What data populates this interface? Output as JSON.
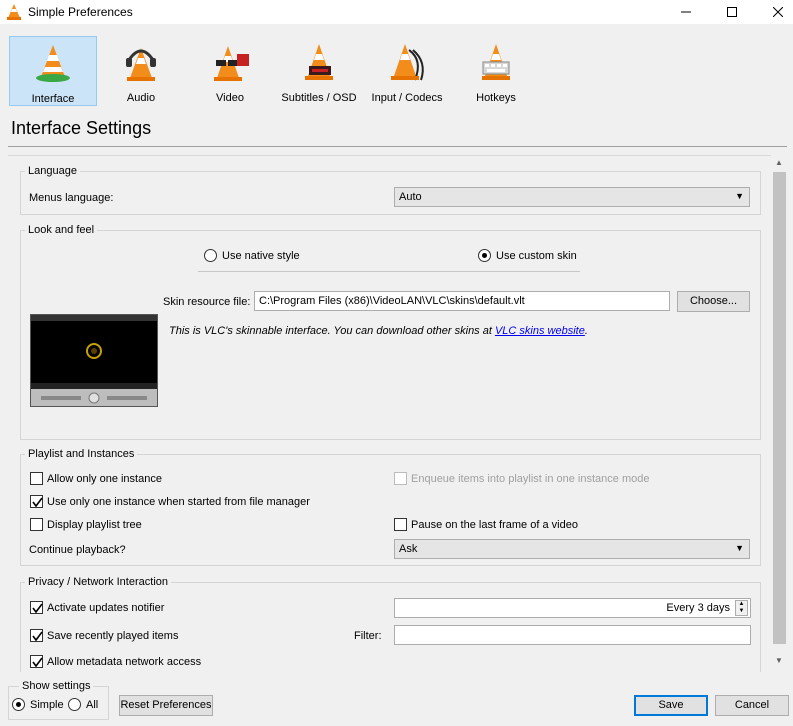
{
  "window": {
    "title": "Simple Preferences",
    "minimize_icon": "minimize-icon",
    "maximize_icon": "maximize-icon",
    "close_icon": "close-icon"
  },
  "categories": [
    {
      "label": "Interface",
      "icon": "interface-cone-icon",
      "selected": true
    },
    {
      "label": "Audio",
      "icon": "audio-headphones-cone-icon",
      "selected": false
    },
    {
      "label": "Video",
      "icon": "video-glasses-cone-icon",
      "selected": false
    },
    {
      "label": "Subtitles / OSD",
      "icon": "subtitles-cone-icon",
      "selected": false
    },
    {
      "label": "Input / Codecs",
      "icon": "input-codecs-cone-icon",
      "selected": false
    },
    {
      "label": "Hotkeys",
      "icon": "hotkeys-cone-icon",
      "selected": false
    }
  ],
  "settings_title": "Interface Settings",
  "language": {
    "group_title": "Language",
    "menus_label": "Menus language:",
    "menus_value": "Auto"
  },
  "look": {
    "group_title": "Look and feel",
    "native_label": "Use native style",
    "custom_label": "Use custom skin",
    "selected": "custom",
    "skin_label": "Skin resource file:",
    "skin_value": "C:\\Program Files (x86)\\VideoLAN\\VLC\\skins\\default.vlt",
    "choose_label": "Choose...",
    "info_text": "This is VLC's skinnable interface. You can download other skins at ",
    "link_text": "VLC skins website",
    "info_end": "."
  },
  "playlist": {
    "group_title": "Playlist and Instances",
    "one_instance": {
      "label": "Allow only one instance",
      "checked": false
    },
    "enqueue": {
      "label": "Enqueue items into playlist in one instance mode",
      "checked": false,
      "enabled": false
    },
    "file_manager": {
      "label": "Use only one instance when started from file manager",
      "checked": true
    },
    "playlist_tree": {
      "label": "Display playlist tree",
      "checked": false
    },
    "pause_last": {
      "label": "Pause on the last frame of a video",
      "checked": false
    },
    "continue_label": "Continue playback?",
    "continue_value": "Ask"
  },
  "privacy": {
    "group_title": "Privacy / Network Interaction",
    "updates": {
      "label": "Activate updates notifier",
      "checked": true
    },
    "updates_value": "Every 3 days",
    "recent": {
      "label": "Save recently played items",
      "checked": true
    },
    "filter_label": "Filter:",
    "filter_value": "",
    "metadata": {
      "label": "Allow metadata network access",
      "checked": true
    }
  },
  "footer": {
    "show_settings_title": "Show settings",
    "simple_label": "Simple",
    "all_label": "All",
    "selected": "simple",
    "reset_label": "Reset Preferences",
    "save_label": "Save",
    "cancel_label": "Cancel"
  },
  "colors": {
    "accent": "#0078d7",
    "selected_tab_bg": "#cce4f7",
    "cone_orange": "#f28c1a"
  }
}
